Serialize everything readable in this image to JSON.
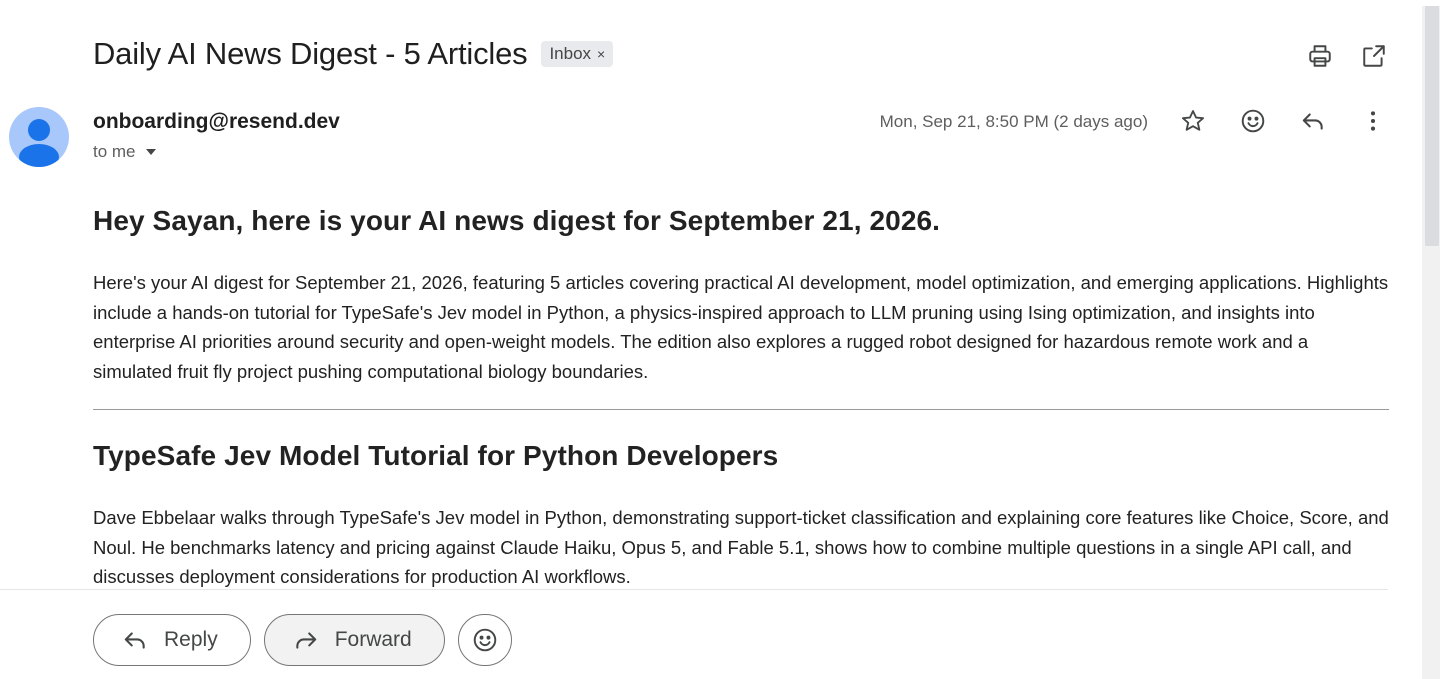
{
  "email": {
    "subject": "Daily AI News Digest - 5 Articles",
    "label": "Inbox",
    "label_remove": "×",
    "sender": "onboarding@resend.dev",
    "recipient": "to me",
    "date": "Mon, Sep 21, 8:50 PM (2 days ago)"
  },
  "icons": {
    "print": "print-icon",
    "open_new_window": "open-in-new-window-icon",
    "star": "star-icon",
    "emoji": "emoji-icon",
    "reply": "reply-icon",
    "more": "more-vert-icon",
    "avatar": "person-avatar-icon"
  },
  "content": {
    "greeting": "Hey Sayan, here is your AI news digest for September 21, 2026.",
    "intro": "Here's your AI digest for September 21, 2026, featuring 5 articles covering practical AI development, model optimization, and emerging applications. Highlights include a hands-on tutorial for TypeSafe's Jev model in Python, a physics-inspired approach to LLM pruning using Ising optimization, and insights into enterprise AI priorities around security and open-weight models. The edition also explores a rugged robot designed for hazardous remote work and a simulated fruit fly project pushing computational biology boundaries.",
    "articles": [
      {
        "title": "TypeSafe Jev Model Tutorial for Python Developers",
        "summary": "Dave Ebbelaar walks through TypeSafe's Jev model in Python, demonstrating support-ticket classification and explaining core features like Choice, Score, and Noul. He benchmarks latency and pricing against Claude Haiku, Opus 5, and Fable 5.1, shows how to combine multiple questions in a single API call, and discusses deployment considerations for production AI workflows."
      }
    ]
  },
  "footer": {
    "reply_label": "Reply",
    "forward_label": "Forward"
  },
  "colors": {
    "avatar_bg": "#a8c7fa",
    "avatar_fg": "#1a73e8",
    "chip_bg": "#e8eaed"
  }
}
